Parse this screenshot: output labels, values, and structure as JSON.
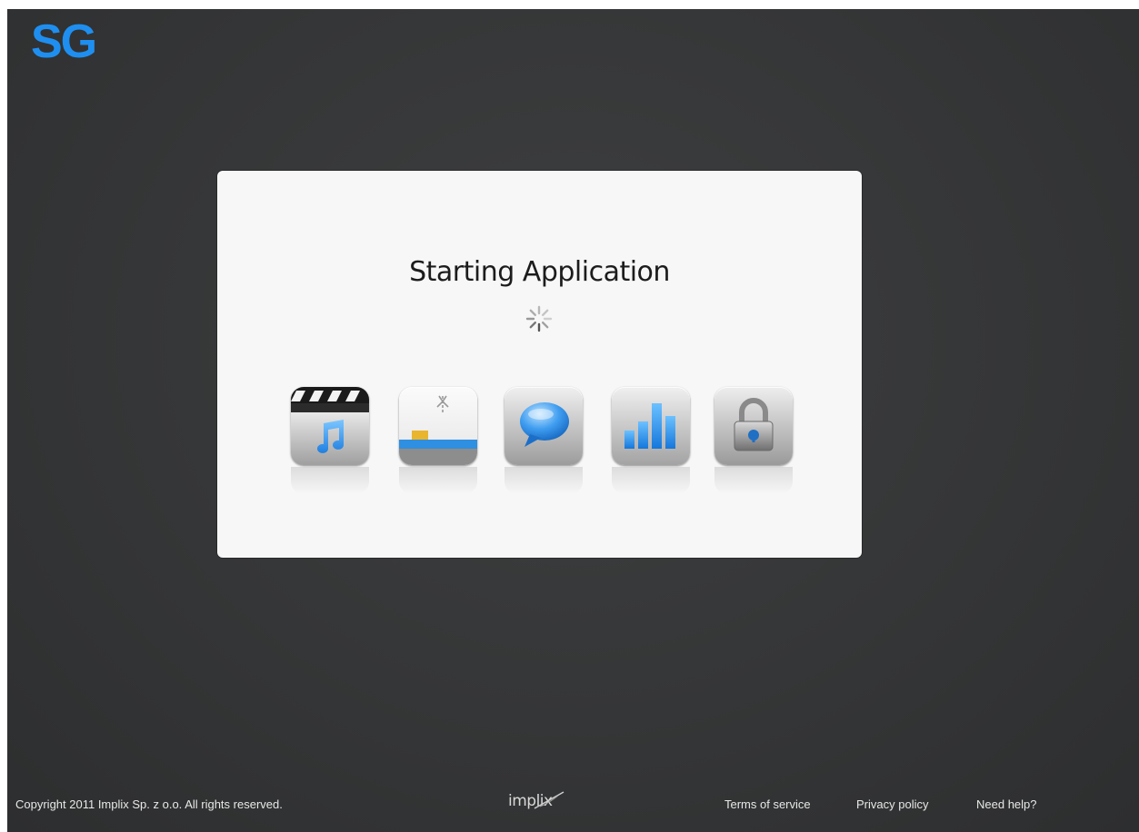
{
  "header": {
    "logo_text": "SG",
    "logo_color": "#1e8ff0"
  },
  "dialog": {
    "title": "Starting Application",
    "loading": true,
    "apps": [
      {
        "name": "video-music-icon"
      },
      {
        "name": "upload-icon"
      },
      {
        "name": "chat-bubble-icon"
      },
      {
        "name": "bar-chart-icon"
      },
      {
        "name": "padlock-icon"
      }
    ]
  },
  "footer": {
    "copyright": "Copyright 2011 Implix Sp. z o.o. All rights reserved.",
    "brand": "implix",
    "links": {
      "terms": "Terms of service",
      "privacy": "Privacy policy",
      "help": "Need help?"
    }
  },
  "colors": {
    "background": "#353637",
    "accent": "#1e8ff0",
    "dialog": "#f7f7f7"
  }
}
